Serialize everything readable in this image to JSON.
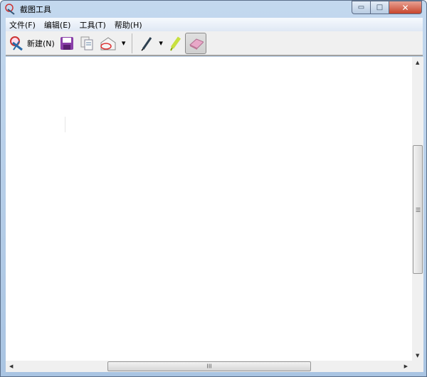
{
  "title": "截图工具",
  "window_controls": {
    "minimize": "▭",
    "maximize": "□",
    "close": "✕"
  },
  "menu": [
    "文件(F)",
    "编辑(E)",
    "工具(T)",
    "帮助(H)"
  ],
  "toolbar": {
    "new_label": "新建(N)",
    "dropdown": "▾"
  },
  "scroll": {
    "grip": "III",
    "up": "▲",
    "down": "▼",
    "left": "◀",
    "right": "▶"
  }
}
